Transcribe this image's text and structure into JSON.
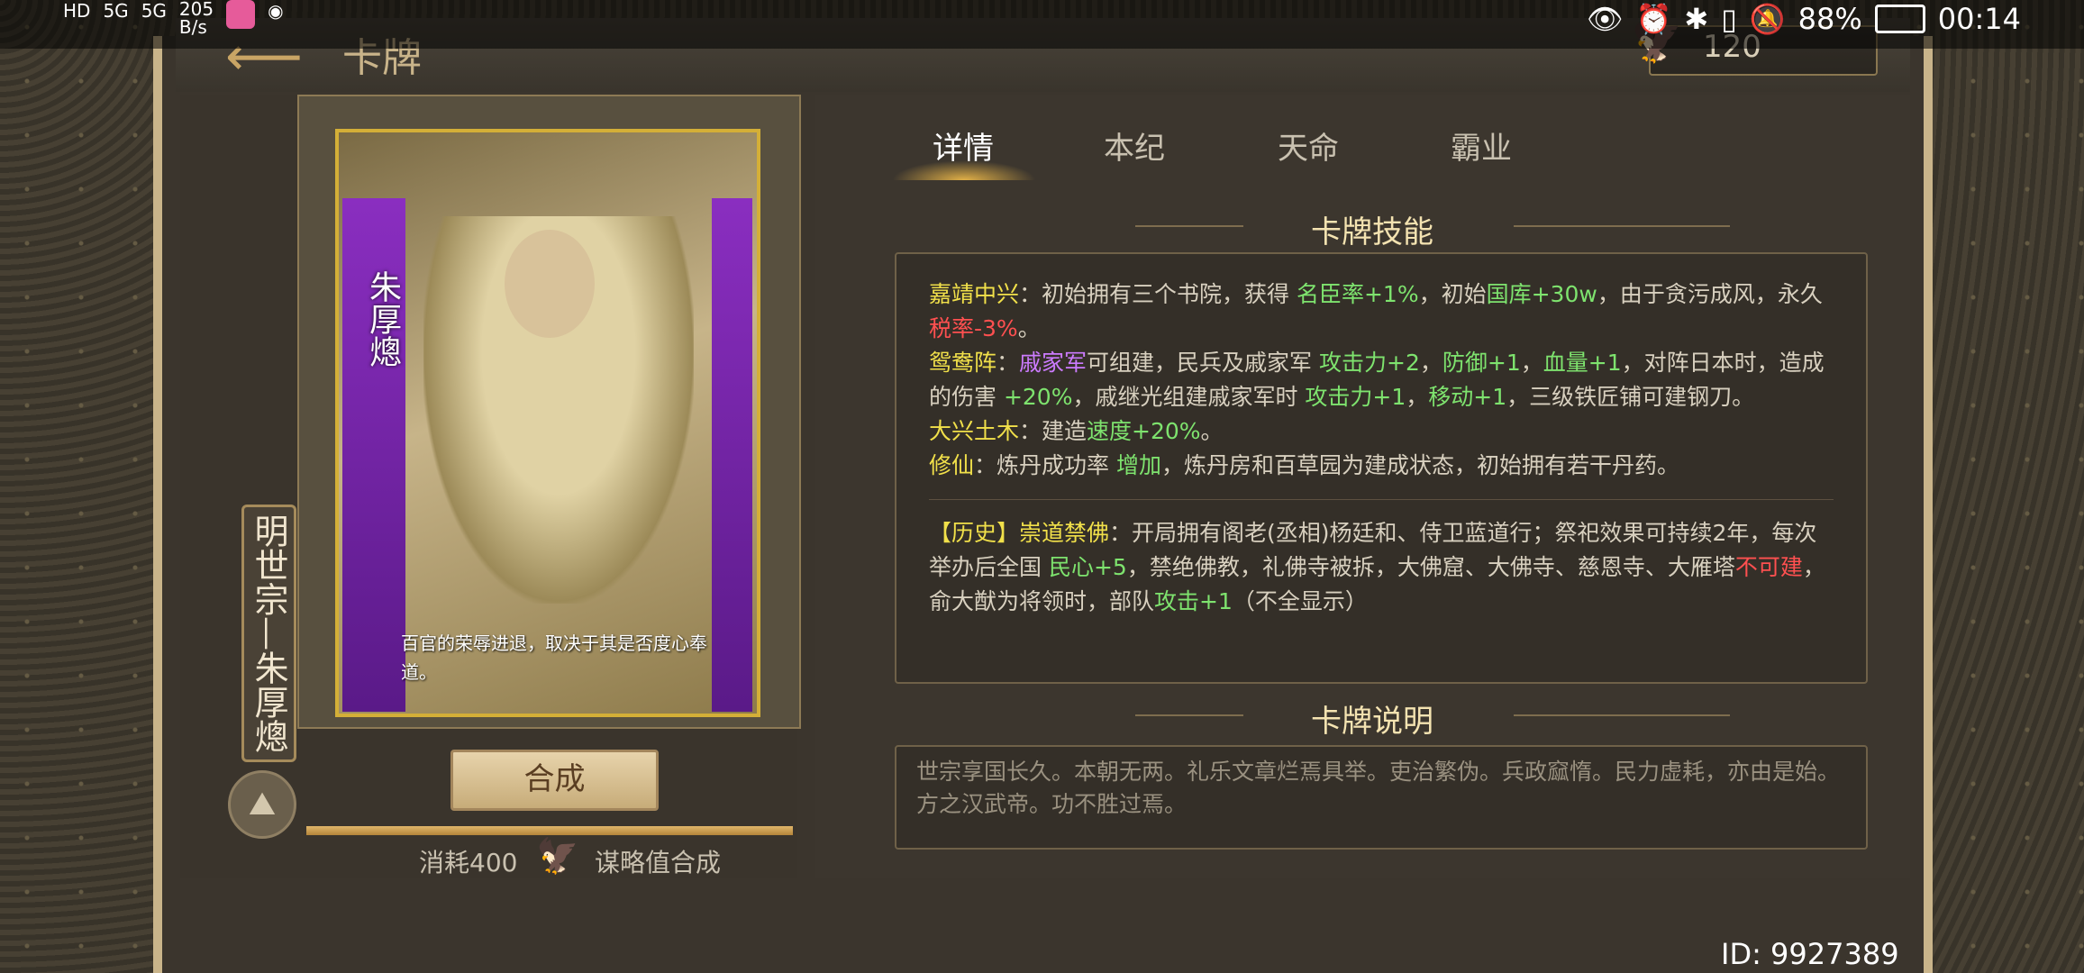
{
  "status_bar": {
    "net_speed": "205\nB/s",
    "battery": "88%",
    "time": "00:14",
    "signal_labels": [
      "HD",
      "5G",
      "5G"
    ]
  },
  "header": {
    "title": "卡牌",
    "currency": "120"
  },
  "card": {
    "name_vertical": "朱厚熜",
    "quote": "百官的荣辱进退，取决于其是否度心奉道。",
    "name_tag": "明世宗—朱厚熜",
    "compose_button": "合成",
    "progress": 1,
    "cost_prefix": "消耗400",
    "cost_suffix": "谋略值合成"
  },
  "tabs": [
    {
      "label": "详情",
      "active": true
    },
    {
      "label": "本纪",
      "active": false
    },
    {
      "label": "天命",
      "active": false
    },
    {
      "label": "霸业",
      "active": false
    }
  ],
  "sections": {
    "skills_title": "卡牌技能",
    "desc_title": "卡牌说明"
  },
  "skills": {
    "s1_name": "嘉靖中兴",
    "s1_a": "：初始拥有三个书院，获得 ",
    "s1_b": "名臣率+1%",
    "s1_c": "，初始",
    "s1_d": "国库+30w",
    "s1_e": "，由于贪污成风，永久",
    "s1_f": "税率-3%",
    "s1_g": "。",
    "s2_name": "鸳鸯阵",
    "s2_a": "：",
    "s2_b": "戚家军",
    "s2_c": "可组建，民兵及戚家军 ",
    "s2_d": "攻击力+2",
    "s2_e": "，",
    "s2_f": "防御+1",
    "s2_g": "，",
    "s2_h": "血量+1",
    "s2_i": "，对阵日本时，造成的伤害 ",
    "s2_j": "+20%",
    "s2_k": "，戚继光组建戚家军时 ",
    "s2_l": "攻击力+1",
    "s2_m": "，",
    "s2_n": "移动+1",
    "s2_o": "，三级铁匠铺可建钢刀。",
    "s3_name": "大兴土木",
    "s3_a": "：建造",
    "s3_b": "速度+20%",
    "s3_c": "。",
    "s4_name": "修仙",
    "s4_a": "：炼丹成功率 ",
    "s4_b": "增加",
    "s4_c": "，炼丹房和百草园为建成状态，初始拥有若干丹药。",
    "h_name": "【历史】崇道禁佛",
    "h_a": "：开局拥有阁老(丞相)杨廷和、侍卫蓝道行；祭祀效果可持续2年，每次举办后全国 ",
    "h_b": "民心+5",
    "h_c": "，禁绝佛教，礼佛寺被拆，大佛窟、大佛寺、慈恩寺、大雁塔",
    "h_d": "不可建",
    "h_e": "，俞大猷为将领时，部队",
    "h_f": "攻击+1",
    "h_g": "（不全显示）"
  },
  "description": "世宗享国长久。本朝无两。礼乐文章烂焉具举。吏治繁伪。兵政窳惰。民力虚耗，亦由是始。方之汉武帝。功不胜过焉。",
  "footer": {
    "id": "ID: 9927389"
  }
}
